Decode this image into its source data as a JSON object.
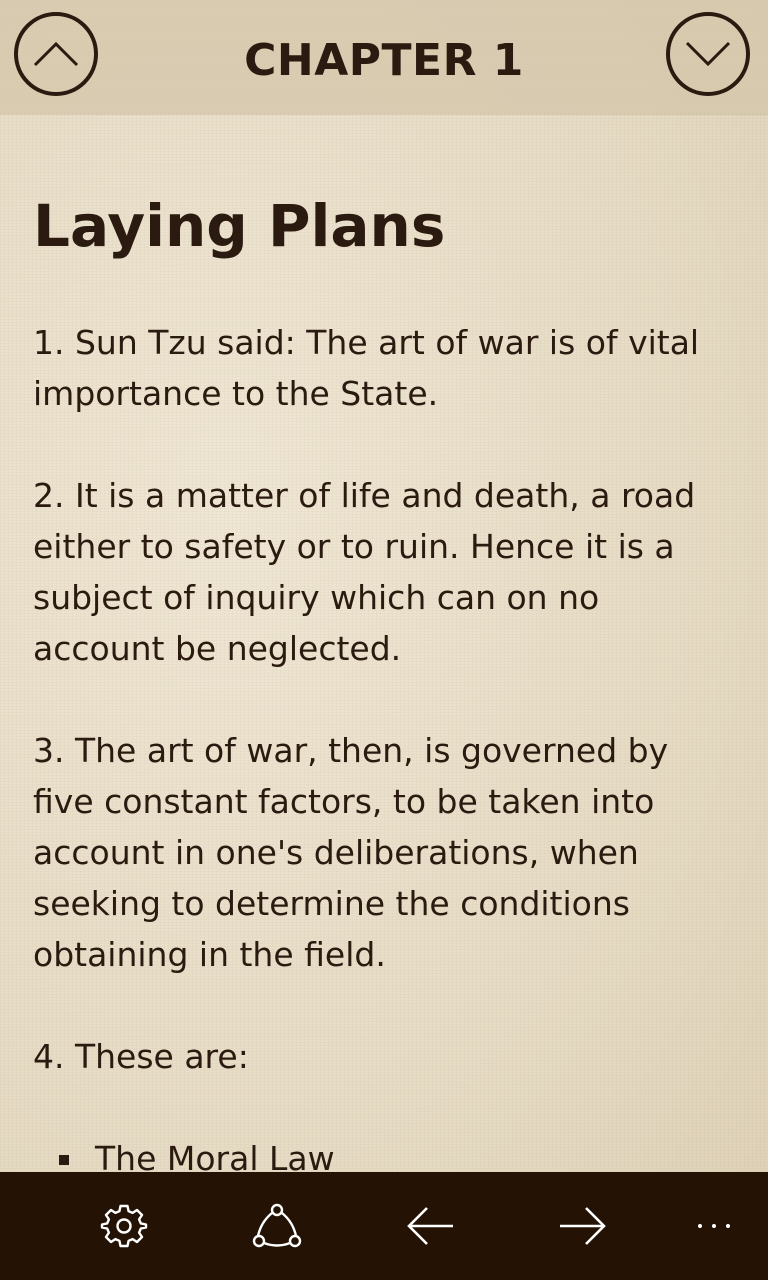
{
  "header": {
    "chapter_title": "CHAPTER 1",
    "prev_icon": "chevron-up-icon",
    "next_icon": "chevron-down-icon"
  },
  "content": {
    "section_title": "Laying Plans",
    "paragraphs": [
      "1. Sun Tzu said: The art of war is of vital\nimportance to the State.",
      "2. It is a matter of life and death, a road\neither to safety or to ruin. Hence it is a\nsubject of inquiry which can on no\naccount be neglected.",
      "3. The art of war, then, is governed by\nfive constant factors, to be taken into\naccount in one's deliberations, when\nseeking to determine the conditions\nobtaining in the field.",
      "4. These are:"
    ],
    "list_items": [
      "The Moral Law"
    ]
  },
  "appbar": {
    "buttons": [
      {
        "icon": "gear-icon"
      },
      {
        "icon": "share-icon"
      },
      {
        "icon": "arrow-left-icon"
      },
      {
        "icon": "arrow-right-icon"
      },
      {
        "icon": "more-icon"
      }
    ]
  },
  "colors": {
    "text": "#2a1a0f",
    "appbar_bg": "#241305",
    "page_bg": "#e9dfcb",
    "appbar_icon": "#ffffff"
  }
}
